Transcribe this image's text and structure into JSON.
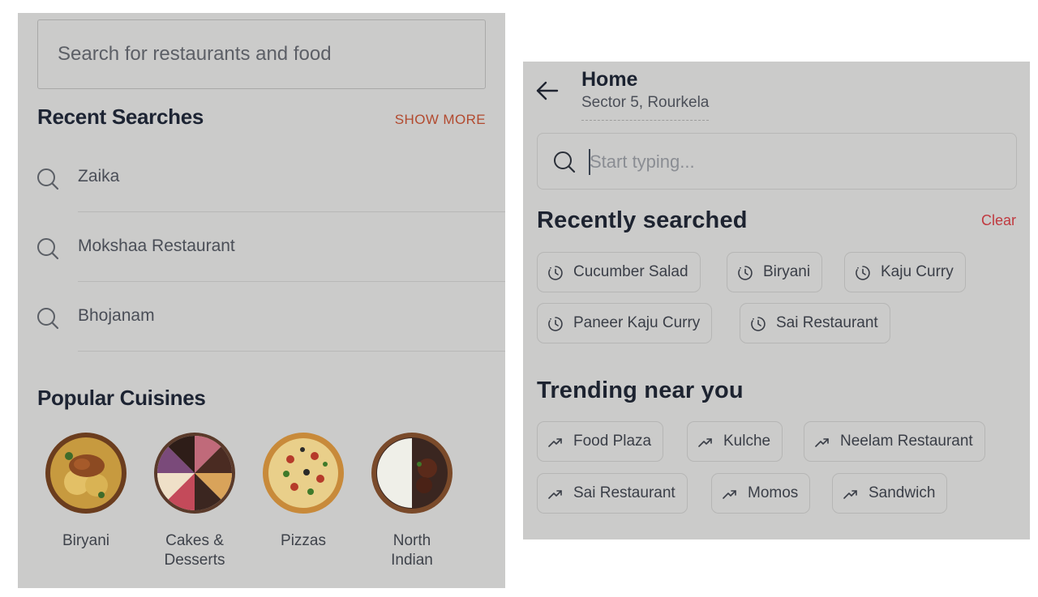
{
  "left": {
    "search_placeholder": "Search for restaurants and food",
    "recent_title": "Recent Searches",
    "show_more": "SHOW MORE",
    "recent_items": [
      {
        "label": "Zaika",
        "icon": "search-icon"
      },
      {
        "label": "Mokshaa Restaurant",
        "icon": "search-icon"
      },
      {
        "label": "Bhojanam",
        "icon": "search-icon"
      }
    ],
    "popular_title": "Popular Cuisines",
    "cuisines": [
      {
        "line1": "Biryani",
        "line2": ""
      },
      {
        "line1": "Cakes &",
        "line2": "Desserts"
      },
      {
        "line1": "Pizzas",
        "line2": ""
      },
      {
        "line1": "North",
        "line2": "Indian"
      }
    ]
  },
  "right": {
    "location_title": "Home",
    "location_subtitle": "Sector 5, Rourkela",
    "search_placeholder": "Start typing...",
    "recently_title": "Recently searched",
    "clear_label": "Clear",
    "recent_chips": [
      "Cucumber Salad",
      "Biryani",
      "Kaju Curry",
      "Paneer Kaju Curry",
      "Sai Restaurant"
    ],
    "trending_title": "Trending near you",
    "trending_chips": [
      "Food Plaza",
      "Kulche",
      "Neelam Restaurant",
      "Sai Restaurant",
      "Momos",
      "Sandwich"
    ]
  },
  "colors": {
    "panel_bg": "#cbcbca",
    "accent_orange": "#b24a2f",
    "clear_red": "#c0393f",
    "title_text": "#1d2433"
  },
  "icons": {
    "recent_chip_icon": "history-clock-icon",
    "trending_chip_icon": "trending-arrow-icon",
    "back_icon": "back-arrow-icon"
  }
}
